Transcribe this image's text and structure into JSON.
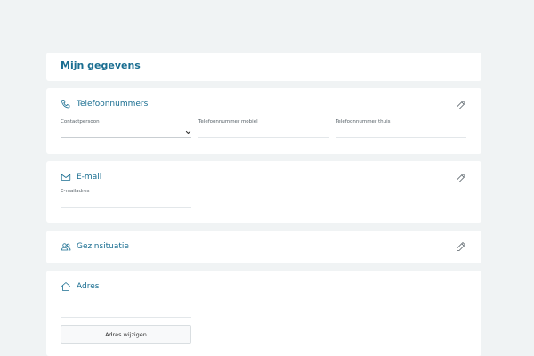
{
  "page": {
    "title": "Mijn gegevens"
  },
  "phone_section": {
    "title": "Telefoonnummers",
    "icon": "phone-icon",
    "fields": {
      "contact_label": "Contactpersoon",
      "mobile_label": "Telefoonnummer mobiel",
      "home_label": "Telefoonnummer thuis"
    }
  },
  "email_section": {
    "title": "E-mail",
    "icon": "mail-icon",
    "fields": {
      "email_label": "E-mailadres"
    }
  },
  "family_section": {
    "title": "Gezinsituatie",
    "icon": "users-icon"
  },
  "address_section": {
    "title": "Adres",
    "icon": "home-icon",
    "button_label": "Adres wijzigen"
  },
  "colors": {
    "accent": "#1a6e91",
    "background": "#f0f3f4",
    "card": "#ffffff"
  }
}
